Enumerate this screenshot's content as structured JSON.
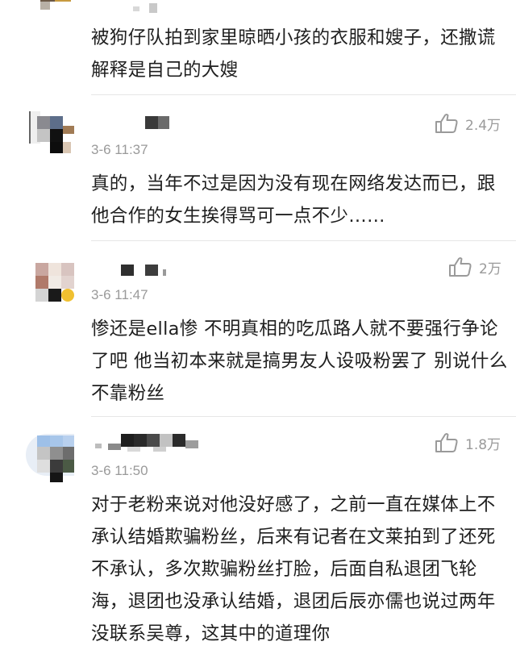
{
  "colors": {
    "text": "#1f1f1f",
    "meta": "#9a9a9a",
    "divider": "#e6e6e6",
    "background": "#ffffff"
  },
  "icons": {
    "like": "thumbs-up-icon"
  },
  "comments": [
    {
      "text": "被狗仔队拍到家里晾晒小孩的衣服和嫂子，还撒谎解释是自己的大嫂"
    },
    {
      "likes": "2.4万",
      "time": "3-6 11:37",
      "text": "真的，当年不过是因为没有现在网络发达而已，跟他合作的女生挨得骂可一点不少……"
    },
    {
      "likes": "2万",
      "time": "3-6 11:47",
      "text": "惨还是ella惨 不明真相的吃瓜路人就不要强行争论了吧 他当初本来就是搞男友人设吸粉罢了 别说什么不靠粉丝"
    },
    {
      "likes": "1.8万",
      "time": "3-6 11:50",
      "text": "对于老粉来说对他没好感了，之前一直在媒体上不承认结婚欺骗粉丝，后来有记者在文莱拍到了还死不承认，多次欺骗粉丝打脸，后面自私退团飞轮海，退团也没承认结婚，退团后辰亦儒也说过两年没联系吴尊，这其中的道理你"
    }
  ]
}
